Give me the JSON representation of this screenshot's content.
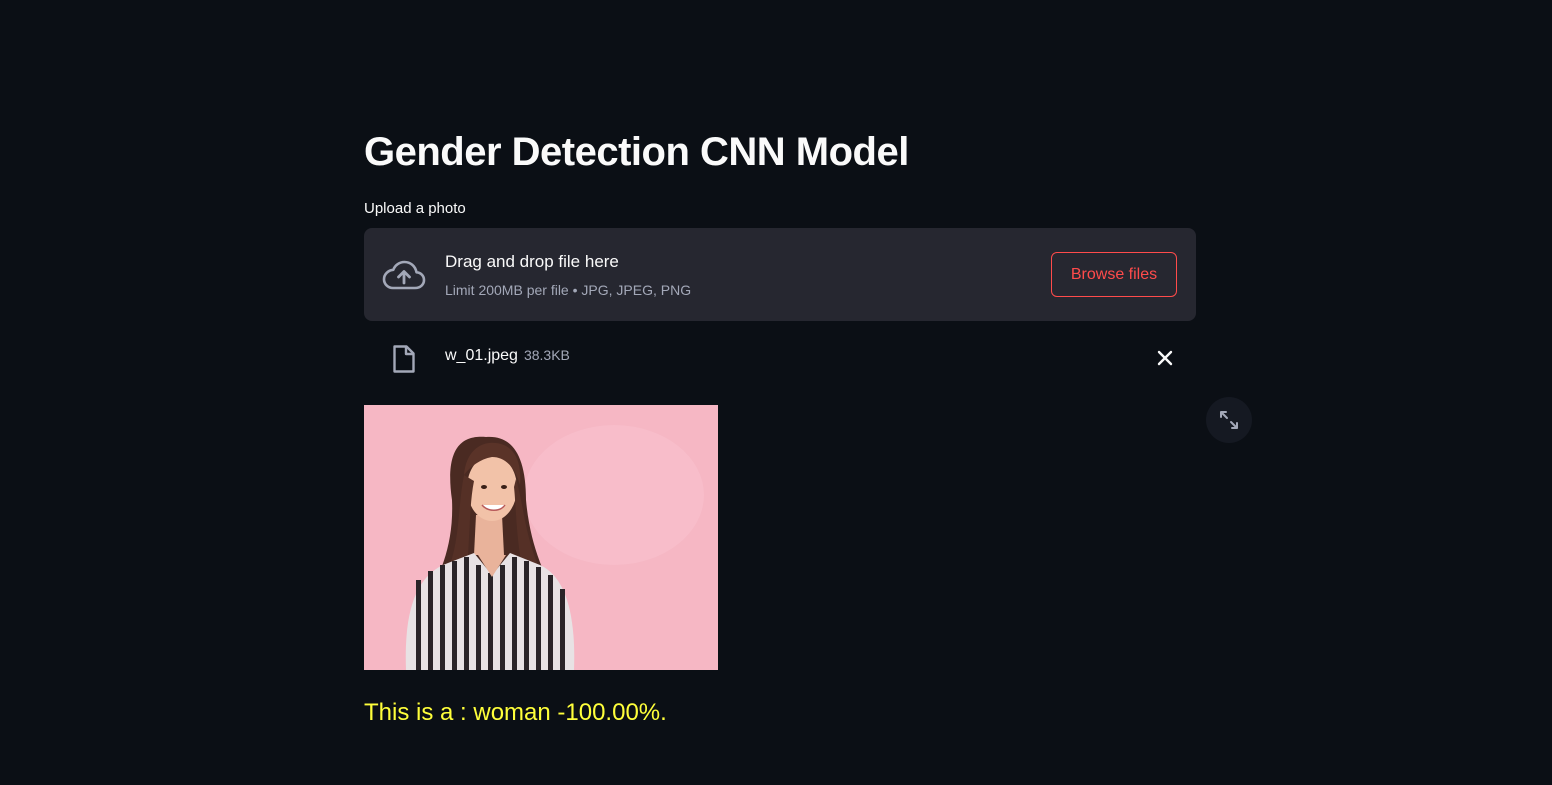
{
  "app": {
    "title": "Gender Detection CNN Model"
  },
  "uploader": {
    "label": "Upload a photo",
    "drop_text": "Drag and drop file here",
    "limit_text": "Limit 200MB per file • JPG, JPEG, PNG",
    "browse_label": "Browse files",
    "icon": "cloud-upload-icon"
  },
  "uploaded_file": {
    "name": "w_01.jpeg",
    "size": "38.3KB",
    "icon": "file-icon",
    "remove_icon": "close-icon"
  },
  "image": {
    "expand_icon": "fullscreen-icon"
  },
  "result": {
    "text": "This is a : woman -100.00%."
  },
  "colors": {
    "background": "#0b0f15",
    "dropzone": "#262730",
    "accent": "#ff4b4b",
    "result_text": "#ffff3a",
    "photo_background": "#f6b7c4"
  }
}
